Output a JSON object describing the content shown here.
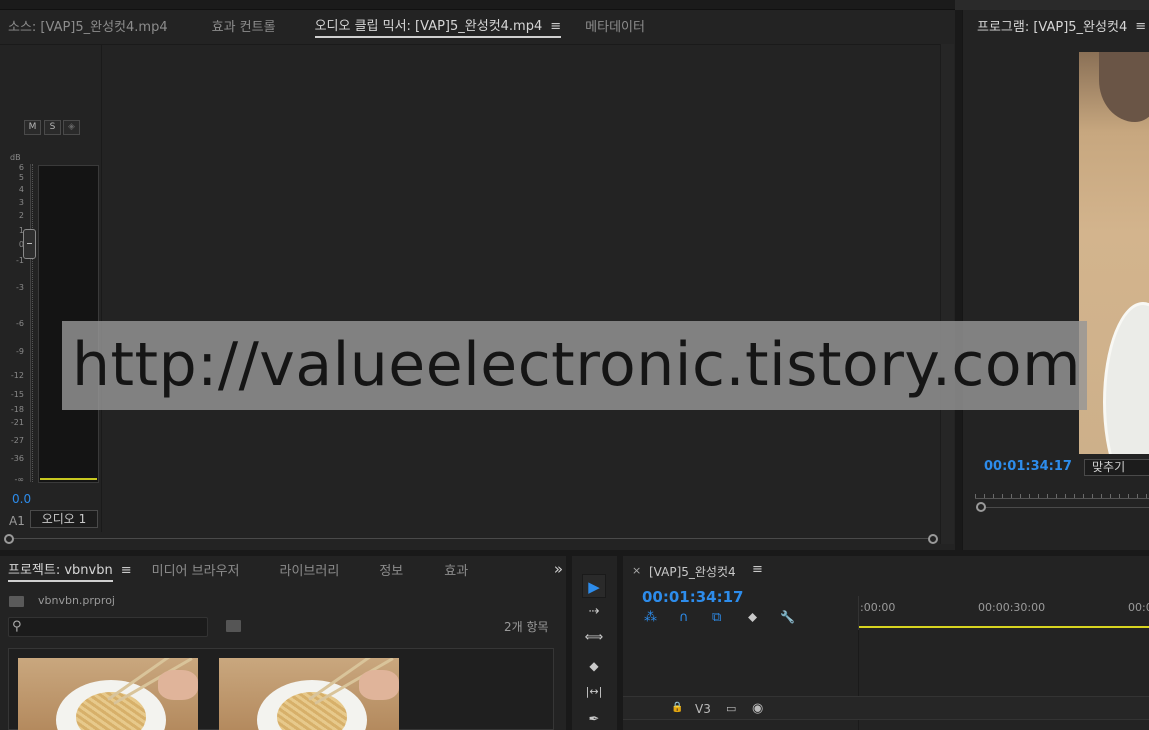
{
  "mixer": {
    "tabs": [
      {
        "label": "소스: [VAP]5_완성컷4.mp4",
        "active": false
      },
      {
        "label": "효과 컨트롤",
        "active": false
      },
      {
        "label": "오디오 클립 믹서: [VAP]5_완성컷4.mp4",
        "active": true
      },
      {
        "label": "메타데이터",
        "active": false
      }
    ],
    "menu_glyph": "≡",
    "buttons": {
      "mute": "M",
      "solo": "S",
      "record": "◈"
    },
    "db_label": "dB",
    "db_ticks": [
      "6",
      "5",
      "4",
      "3",
      "2",
      "1",
      "0",
      "-1",
      "-3",
      "-6",
      "-9",
      "-12",
      "-15",
      "-18",
      "-21",
      "-27",
      "-36",
      "-∞"
    ],
    "level_readout": "0.0",
    "track_label": "A1",
    "track_name": "오디오 1"
  },
  "program": {
    "tab_label": "프로그램: [VAP]5_완성컷4",
    "menu_glyph": "≡",
    "timecode": "00:01:34:17",
    "fit_label": "맞추기"
  },
  "project": {
    "tabs": [
      {
        "label": "프로젝트: vbnvbn",
        "active": true
      },
      {
        "label": "미디어 브라우저",
        "active": false
      },
      {
        "label": "라이브러리",
        "active": false
      },
      {
        "label": "정보",
        "active": false
      },
      {
        "label": "효과",
        "active": false
      }
    ],
    "menu_glyph": "≡",
    "overflow_glyph": "»",
    "file_name": "vbnvbn.prproj",
    "search_glyph": "⚲",
    "item_count": "2개 항목"
  },
  "tools": {
    "select": "▶",
    "track_select": "⇢",
    "ripple": "⟺",
    "razor": "◆",
    "slip": "|↔|",
    "pen": "✒"
  },
  "timeline": {
    "close_glyph": "×",
    "title": "[VAP]5_완성컷4",
    "menu_glyph": "≡",
    "timecode": "00:01:34:17",
    "tool_glyphs": {
      "snap": "⁂",
      "magnet": "∩",
      "linked": "⧉",
      "marker": "⬥",
      "wrench": "🔧"
    },
    "ruler_labels": [
      ":00:00",
      "00:00:30:00",
      "00:0"
    ],
    "track": {
      "lock": "🔒",
      "name": "V3",
      "film": "▭",
      "eye": "◉"
    }
  },
  "watermark": {
    "text": "http://valueelectronic.tistory.com"
  },
  "colors": {
    "accent": "#2d8ceb",
    "work_area": "#d7d420",
    "background": "#232323"
  }
}
